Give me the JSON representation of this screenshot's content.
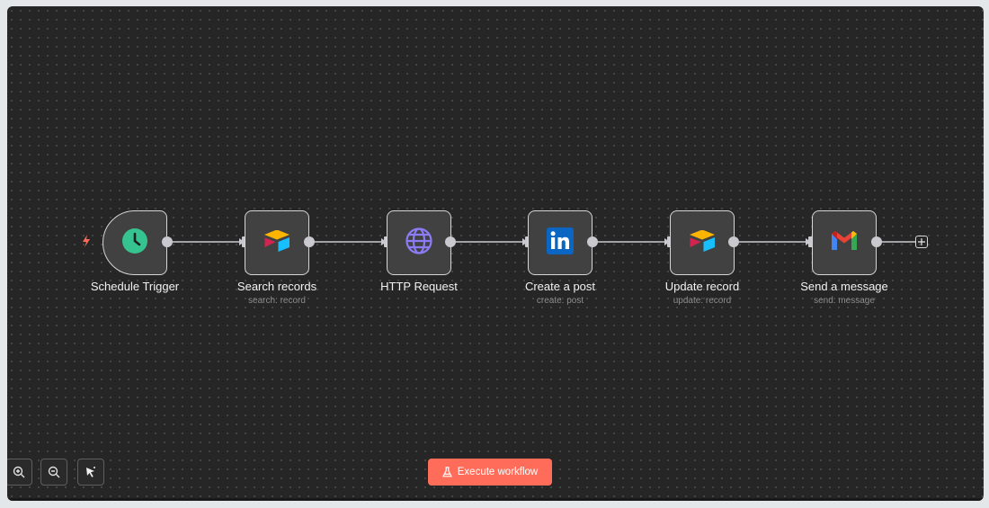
{
  "workflow": {
    "nodes": [
      {
        "id": "schedule-trigger",
        "title": "Schedule Trigger",
        "subtitle": "",
        "icon": "clock-icon"
      },
      {
        "id": "search-records",
        "title": "Search records",
        "subtitle": "search: record",
        "icon": "airtable-icon"
      },
      {
        "id": "http-request",
        "title": "HTTP Request",
        "subtitle": "",
        "icon": "globe-icon"
      },
      {
        "id": "create-post",
        "title": "Create a post",
        "subtitle": "create: post",
        "icon": "linkedin-icon"
      },
      {
        "id": "update-record",
        "title": "Update record",
        "subtitle": "update: record",
        "icon": "airtable-icon"
      },
      {
        "id": "send-message",
        "title": "Send a message",
        "subtitle": "send: message",
        "icon": "gmail-icon"
      }
    ]
  },
  "controls": {
    "zoom_in_icon": "zoom-in-icon",
    "zoom_out_icon": "zoom-out-icon",
    "tidy_icon": "cursor-sparkle-icon"
  },
  "execute": {
    "label": "Execute workflow",
    "icon": "flask-icon"
  },
  "colors": {
    "canvas": "#262626",
    "node_fill": "#414141",
    "node_border": "#d6d6d6",
    "accent": "#ff6d5a",
    "trigger_bolt": "#ff6d5a",
    "clock": "#35c48f",
    "globe": "#8b7cf6",
    "linkedin": "#0a66c2"
  }
}
